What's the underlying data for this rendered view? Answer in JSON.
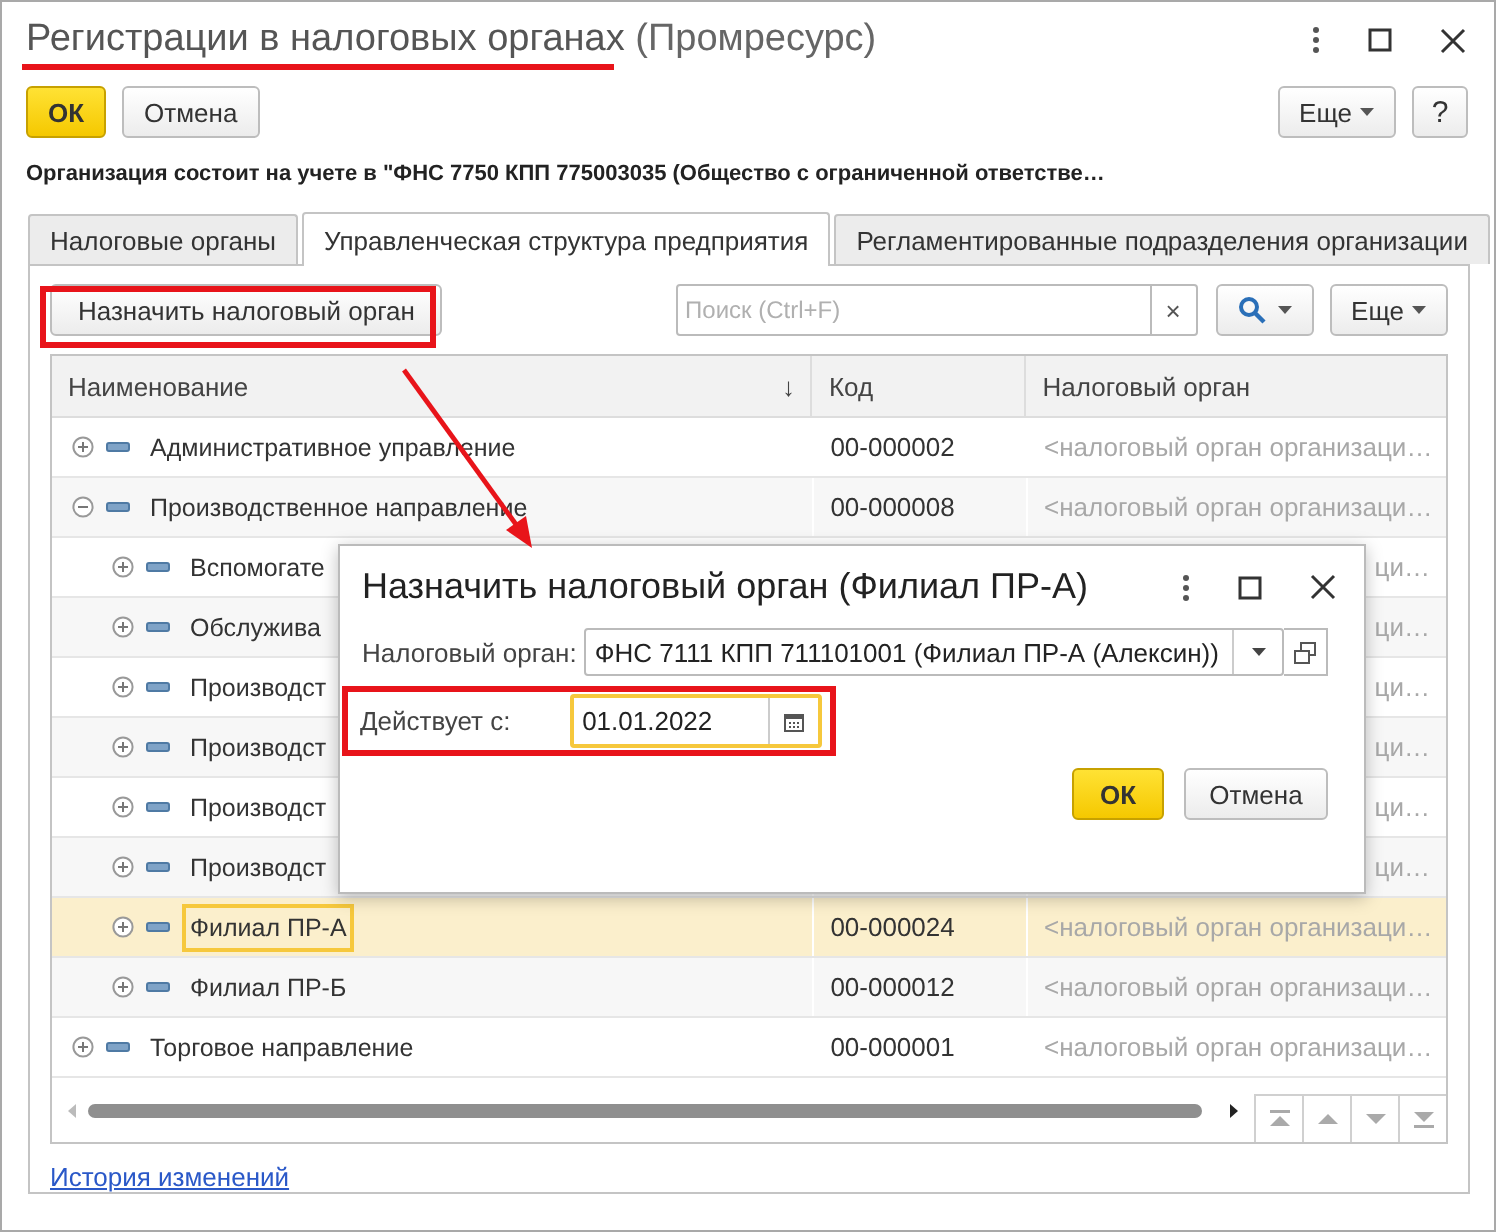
{
  "window": {
    "title": "Регистрации в налоговых органах",
    "subtitle": "(Промресурс)"
  },
  "toolbar": {
    "ok": "ОК",
    "cancel": "Отмена",
    "more": "Еще",
    "help": "?"
  },
  "info": "Организация состоит на учете в \"ФНС 7750 КПП 775003035 (Общество с ограниченной ответстве…",
  "tabs": [
    {
      "label": "Налоговые органы",
      "selected": false
    },
    {
      "label": "Управленческая структура предприятия",
      "selected": true
    },
    {
      "label": "Регламентированные подразделения организации",
      "selected": false
    }
  ],
  "command_bar": {
    "assign_button": "Назначить налоговый орган",
    "search": {
      "placeholder": "Поиск (Ctrl+F)"
    },
    "clear": "×",
    "more": "Еще"
  },
  "table": {
    "columns": [
      {
        "label": "Наименование",
        "sort": "↓"
      },
      {
        "label": "Код"
      },
      {
        "label": "Налоговый орган"
      }
    ],
    "rows": [
      {
        "name": "Административное управление",
        "code": "00-000002",
        "tax_organ": "<налоговый орган организаци…",
        "expanded": false,
        "selected": false
      },
      {
        "name": "Производственное направление",
        "code": "00-000008",
        "tax_organ": "<налоговый орган организаци…",
        "expanded": true,
        "selected": false,
        "children": [
          {
            "name": "Вспомогате",
            "tax_organ": "ци…",
            "expanded": false,
            "selected": false
          },
          {
            "name": "Обслужива",
            "tax_organ": "ци…",
            "expanded": false,
            "selected": false
          },
          {
            "name": "Производст",
            "tax_organ": "ци…",
            "expanded": false,
            "selected": false
          },
          {
            "name": "Производст",
            "tax_organ": "ци…",
            "expanded": false,
            "selected": false
          },
          {
            "name": "Производст",
            "tax_organ": "ци…",
            "expanded": false,
            "selected": false
          },
          {
            "name": "Производст",
            "tax_organ": "ци…",
            "expanded": false,
            "selected": false
          },
          {
            "name": "Филиал ПР-А",
            "code": "00-000024",
            "tax_organ": "<налоговый орган организаци…",
            "expanded": false,
            "selected": true
          },
          {
            "name": "Филиал ПР-Б",
            "code": "00-000012",
            "tax_organ": "<налоговый орган организаци…",
            "expanded": false,
            "selected": false
          }
        ]
      },
      {
        "name": "Торговое направление",
        "code": "00-000001",
        "tax_organ": "<налоговый орган организаци…",
        "expanded": false,
        "selected": false
      }
    ]
  },
  "link": "История изменений",
  "dialog": {
    "title": "Назначить налоговый орган (Филиал ПР-А)",
    "fields": [
      {
        "kind": "select",
        "label": "Налоговый орган:",
        "value": "ФНС 7111 КПП 711101001 (Филиал ПР-А (Алексин))",
        "focused": false
      },
      {
        "kind": "date",
        "label": "Действует с:",
        "value": "01.01.2022",
        "focused": true
      }
    ],
    "ok": "ОК",
    "cancel": "Отмена"
  }
}
